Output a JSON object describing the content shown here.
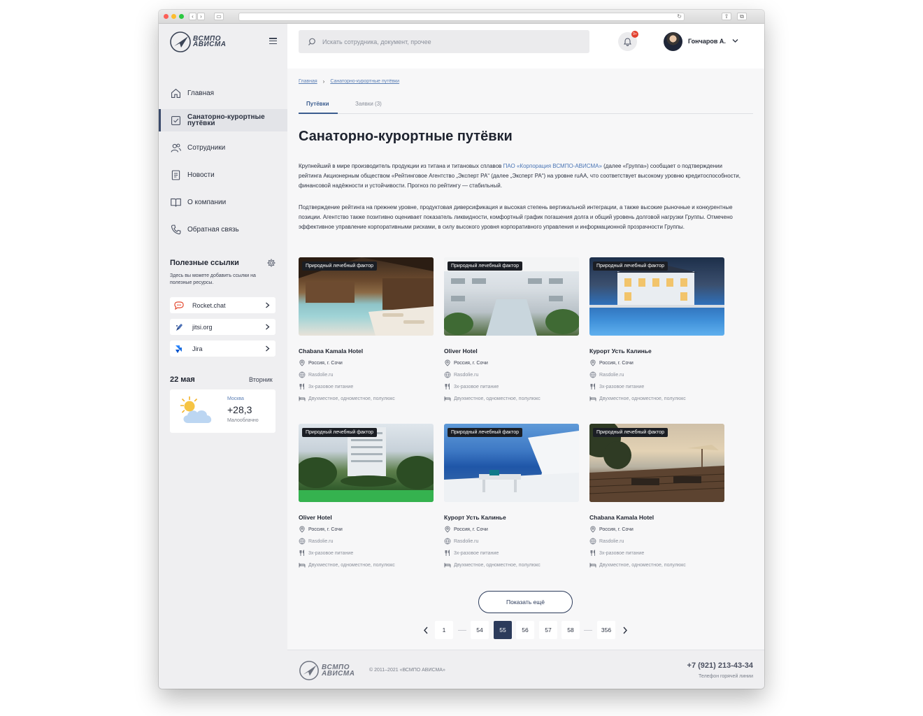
{
  "sidebar": {
    "logo_text_line1": "ВСМПО",
    "logo_text_line2": "АВИСМА",
    "nav": [
      {
        "label": "Главная"
      },
      {
        "label": "Санаторно-курортные путёвки"
      },
      {
        "label": "Сотрудники"
      },
      {
        "label": "Новости"
      },
      {
        "label": "О компании"
      },
      {
        "label": "Обратная связь"
      }
    ],
    "useful": {
      "title": "Полезные ссылки",
      "description": "Здесь вы можете добавить ссылки на полезные ресурсы.",
      "links": [
        {
          "label": "Rocket.chat"
        },
        {
          "label": "jitsi.org"
        },
        {
          "label": "Jira"
        }
      ]
    },
    "date": "22 мая",
    "weekday": "Вторник",
    "weather": {
      "city": "Москва",
      "temp": "+28,3",
      "condition": "Малооблачно"
    }
  },
  "header": {
    "search_placeholder": "Искать сотрудника, документ, прочее",
    "notifications_badge": "9+",
    "user_name": "Гончаров А."
  },
  "main": {
    "breadcrumbs": [
      "Главная",
      "Санаторно-курортные путёвки"
    ],
    "tabs": [
      {
        "label": "Путёвки"
      },
      {
        "label": "Заявки (3)"
      }
    ],
    "title": "Санаторно-курортные путёвки",
    "para1_part1": "Крупнейший в мире производитель продукции из титана и титановых сплавов ",
    "para1_link": "ПАО «Корпорация ВСМПО-АВИСМА»",
    "para1_part2": " (далее «Группа») сообщает о подтверждении рейтинга Акционерным обществом «Рейтинговое Агентство „Эксперт РА“ (далее „Эксперт РА“) на уровне ruAA, что соответствует высокому уровню кредитоспособности, финансовой надёжности и устойчивости. Прогноз по рейтингу — стабильный.",
    "para2": "Подтверждение рейтинга на прежнем уровне, продуктовая диверсификация и высокая степень вертикальной интеграции, а также высокие рыночные и конкурентные позиции. Агентство также позитивно оценивает показатель ликвидности, комфортный график погашения долга и общий уровень долговой нагрузки Группы. Отмечено эффективное управление корпоративными рисками, в силу высокого уровня корпоративного управления и информационной прозрачности Группы.",
    "cards": [
      {
        "tag": "Природный лечебный фактор",
        "name": "Chabana Kamala Hotel",
        "location": "Россия, г. Сочи",
        "site": "Rasdolie.ru",
        "food": "3х-разовое питание",
        "rooms": "Двухместное, одноместное, полулюкс"
      },
      {
        "tag": "Природный лечебный фактор",
        "name": "Oliver Hotel",
        "location": "Россия, г. Сочи",
        "site": "Rasdolie.ru",
        "food": "3х-разовое питание",
        "rooms": "Двухместное, одноместное, полулюкс"
      },
      {
        "tag": "Природный лечебный фактор",
        "name": "Курорт Усть Калинье",
        "location": "Россия, г. Сочи",
        "site": "Rasdolie.ru",
        "food": "3х-разовое питание",
        "rooms": "Двухместное, одноместное, полулюкс"
      },
      {
        "tag": "Природный лечебный фактор",
        "name": "Oliver Hotel",
        "location": "Россия, г. Сочи",
        "site": "Rasdolie.ru",
        "food": "3х-разовое питание",
        "rooms": "Двухместное, одноместное, полулюкс"
      },
      {
        "tag": "Природный лечебный фактор",
        "name": "Курорт Усть Калинье",
        "location": "Россия, г. Сочи",
        "site": "Rasdolie.ru",
        "food": "3х-разовое питание",
        "rooms": "Двухместное, одноместное, полулюкс"
      },
      {
        "tag": "Природный лечебный фактор",
        "name": "Chabana Kamala Hotel",
        "location": "Россия, г. Сочи",
        "site": "Rasdolie.ru",
        "food": "3х-разовое питание",
        "rooms": "Двухместное, одноместное, полулюкс"
      }
    ],
    "show_more": "Показать ещё",
    "pagination": {
      "pages": [
        "1",
        "54",
        "55",
        "56",
        "57",
        "58",
        "356"
      ],
      "current": "55"
    }
  },
  "footer": {
    "logo_text_line1": "ВСМПО",
    "logo_text_line2": "АВИСМА",
    "copyright": "© 2011–2021 «ВСМПО АВИСМА»",
    "phone": "+7 (921) 213-43-34",
    "hotline": "Телефон горячей линии"
  },
  "colors": {
    "accent": "#2c3b5b",
    "link": "#4a75b5",
    "badge": "#e2412f"
  }
}
